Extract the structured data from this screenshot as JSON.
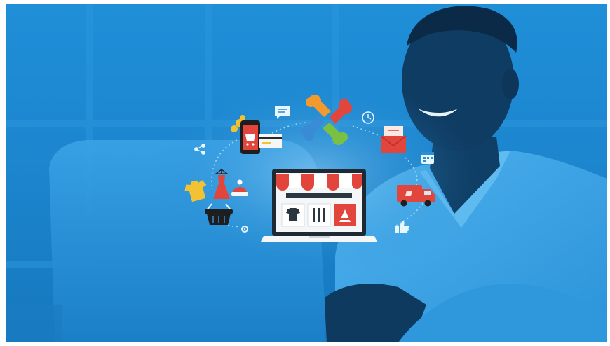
{
  "scene": {
    "description_icons": [
      "joomla-logo-icon",
      "shopping-cart-phone-icon",
      "credit-card-icon",
      "chat-bubble-icon",
      "clock-icon",
      "mail-icon",
      "calendar-icon",
      "delivery-truck-icon",
      "thumbs-up-icon",
      "share-icon",
      "shirt-icon",
      "dress-icon",
      "hat-icon",
      "shopping-basket-icon",
      "gear-icon",
      "online-store-laptop-icon"
    ],
    "colors": {
      "background": "#1c86cf",
      "awning_red": "#e2453c",
      "joomla_orange": "#f39a2e",
      "joomla_red": "#e2453c",
      "joomla_blue": "#3a8bd6",
      "joomla_green": "#7ac143"
    }
  }
}
